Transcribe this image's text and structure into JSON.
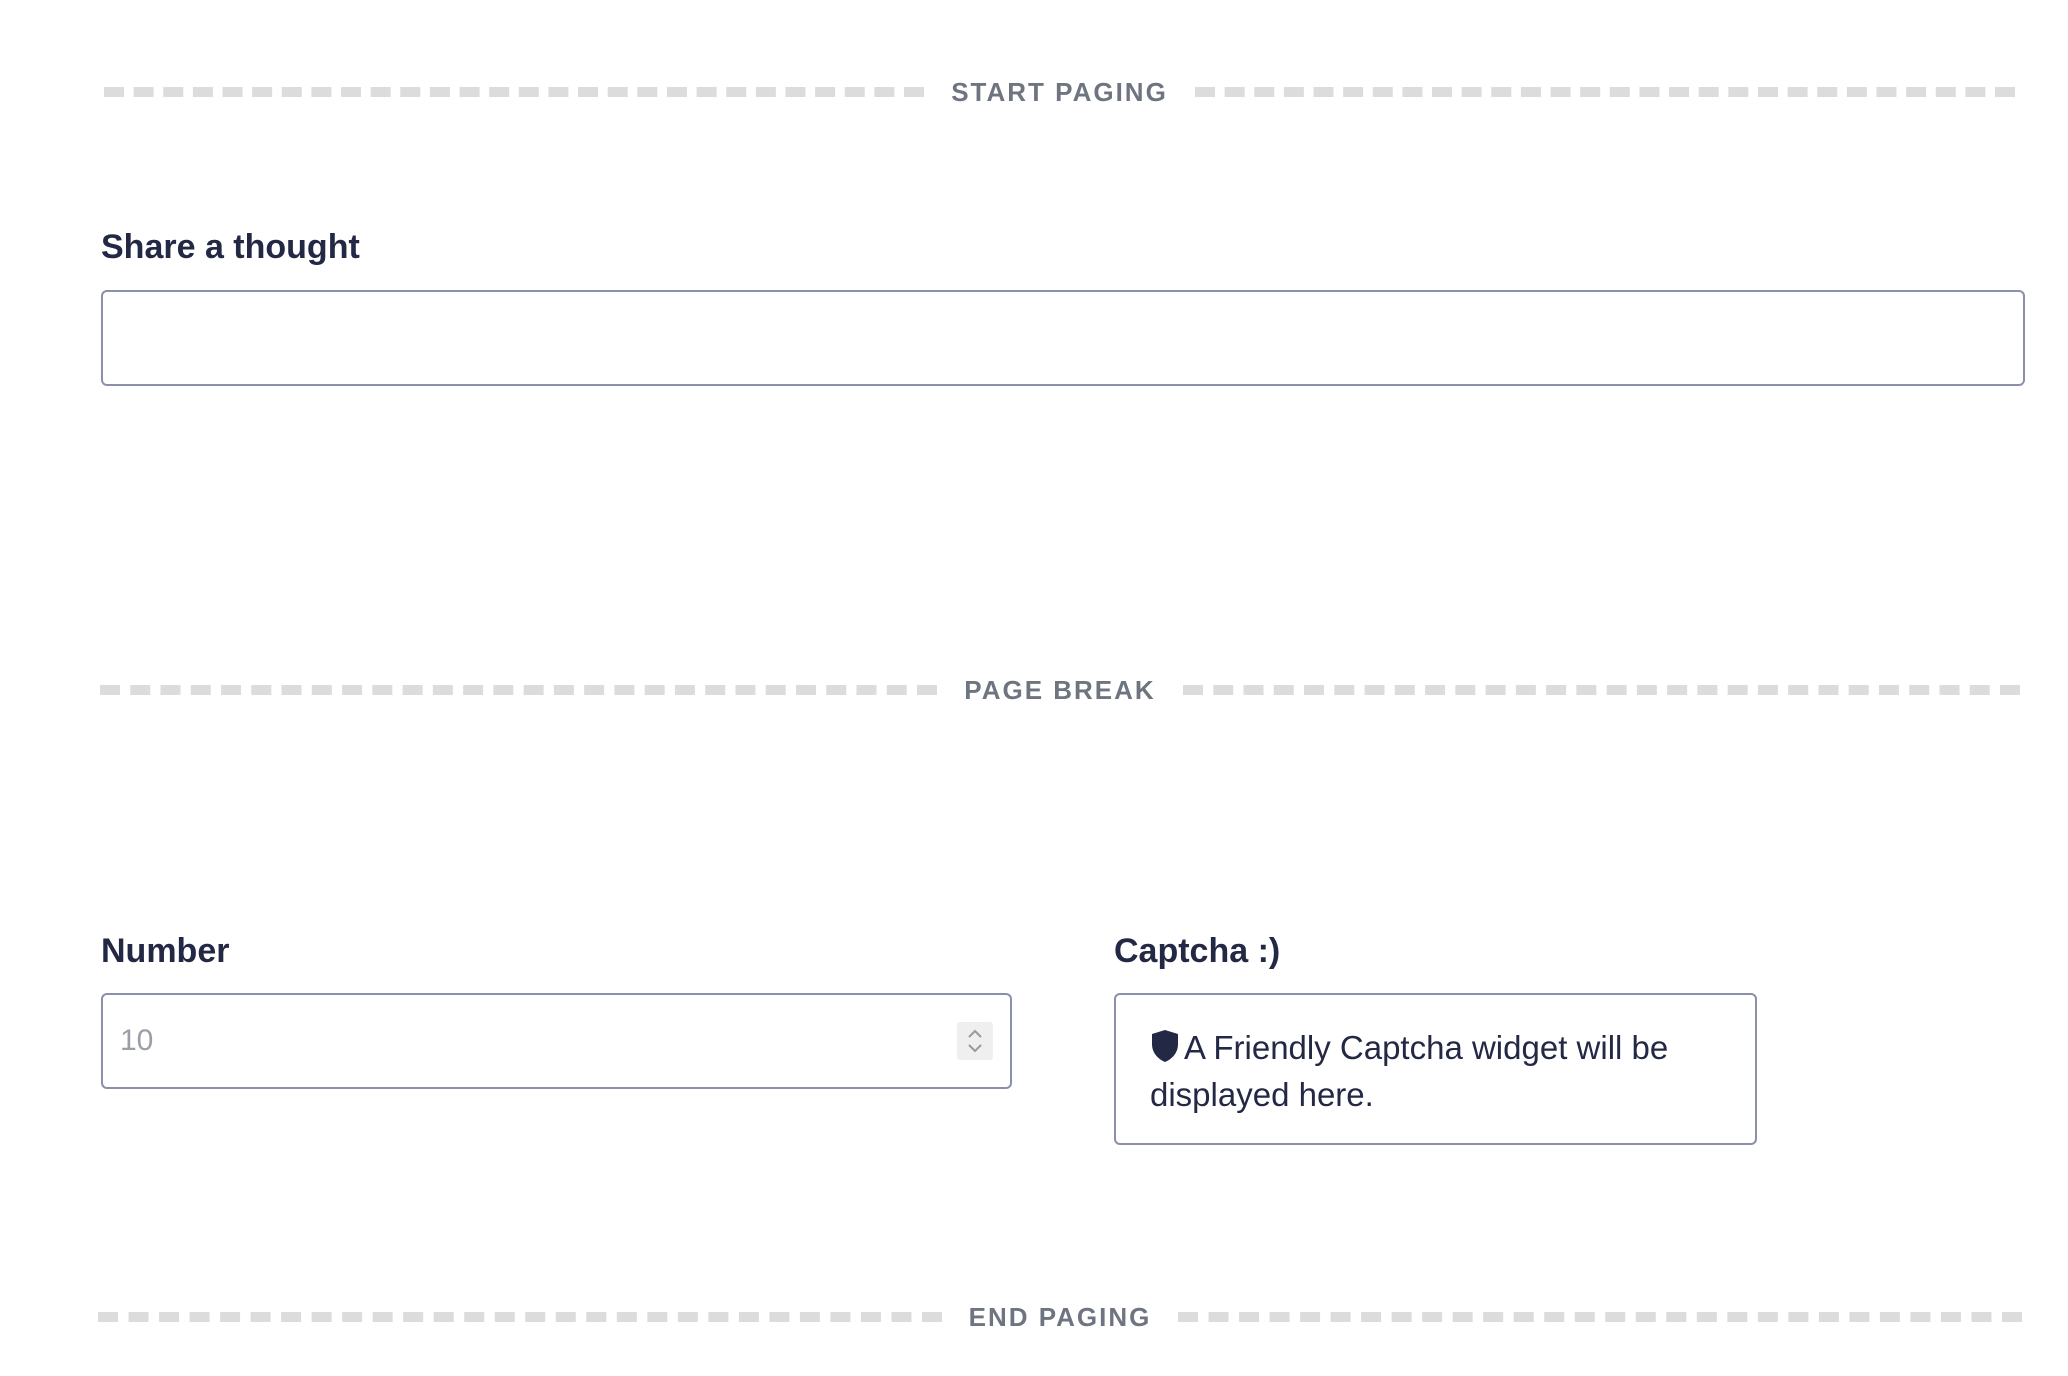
{
  "separators": {
    "start": "START PAGING",
    "page_break": "PAGE BREAK",
    "end": "END PAGING"
  },
  "fields": {
    "thought": {
      "label": "Share a thought",
      "value": "",
      "placeholder": ""
    },
    "number": {
      "label": "Number",
      "placeholder": "10",
      "value": ""
    },
    "captcha": {
      "label": "Captcha :)",
      "message": "A Friendly Captcha widget will be displayed here.",
      "icon": "shield-icon"
    }
  },
  "colors": {
    "text": "#232845",
    "muted": "#6f7580",
    "border": "#8b8fa8",
    "dash": "#dcdcdc"
  }
}
